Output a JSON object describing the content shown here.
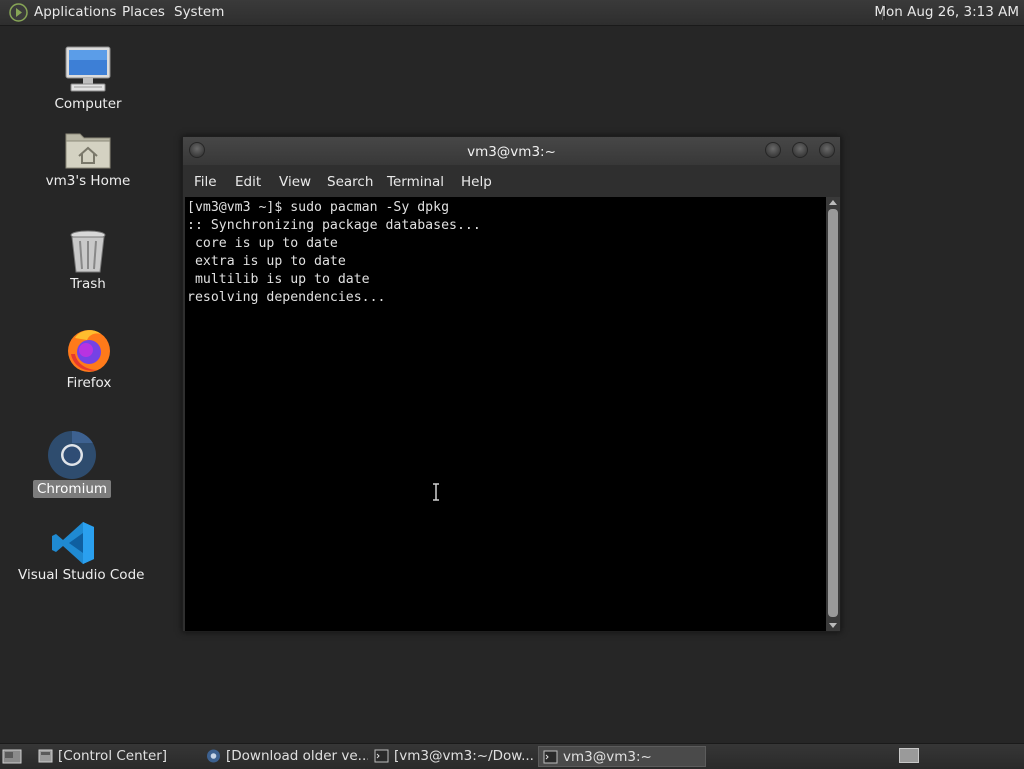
{
  "top_panel": {
    "menus": [
      "Applications",
      "Places",
      "System"
    ],
    "clock": "Mon Aug 26,  3:13 AM"
  },
  "desktop": {
    "icons": [
      {
        "label": "Computer",
        "icon": "computer-icon"
      },
      {
        "label": "vm3's Home",
        "icon": "home-folder-icon"
      },
      {
        "label": "Trash",
        "icon": "trash-icon"
      },
      {
        "label": "Firefox",
        "icon": "firefox-icon"
      },
      {
        "label": "Chromium",
        "icon": "chromium-icon",
        "selected": true
      },
      {
        "label": "Visual Studio Code",
        "icon": "vscode-icon"
      }
    ]
  },
  "terminal": {
    "title": "vm3@vm3:~",
    "menu": [
      "File",
      "Edit",
      "View",
      "Search",
      "Terminal",
      "Help"
    ],
    "output": "[vm3@vm3 ~]$ sudo pacman -Sy dpkg\n:: Synchronizing package databases...\n core is up to date\n extra is up to date\n multilib is up to date\nresolving dependencies..."
  },
  "taskbar": {
    "tasks": [
      {
        "label": "[Control Center]",
        "icon": "control-center-icon",
        "active": false
      },
      {
        "label": "[Download older ve...",
        "icon": "chromium-icon",
        "active": false
      },
      {
        "label": "[vm3@vm3:~/Dow...",
        "icon": "terminal-icon",
        "active": false
      },
      {
        "label": "vm3@vm3:~",
        "icon": "terminal-icon",
        "active": true
      }
    ]
  },
  "colors": {
    "desktop_bg": "#262626",
    "terminal_bg": "#000000",
    "panel_bg": "#333333"
  }
}
